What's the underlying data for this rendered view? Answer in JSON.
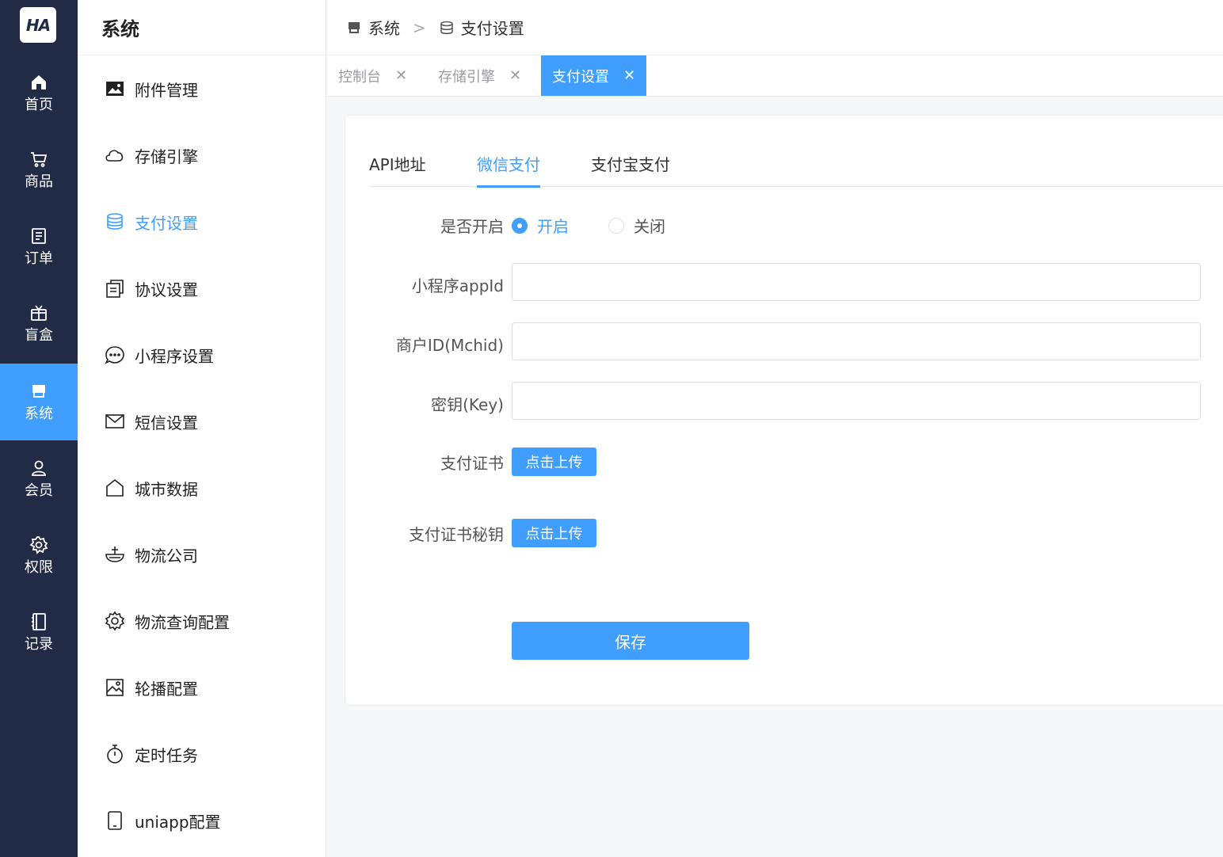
{
  "logo": {
    "text": "HA"
  },
  "rail": {
    "items": [
      {
        "label": "首页",
        "icon": "home-icon"
      },
      {
        "label": "商品",
        "icon": "cart-icon"
      },
      {
        "label": "订单",
        "icon": "document-icon"
      },
      {
        "label": "盲盒",
        "icon": "gift-box-icon"
      },
      {
        "label": "系统",
        "icon": "shop-icon"
      },
      {
        "label": "会员",
        "icon": "user-icon"
      },
      {
        "label": "权限",
        "icon": "gear-icon"
      },
      {
        "label": "记录",
        "icon": "notebook-icon"
      }
    ],
    "active": "系统"
  },
  "submenu": {
    "title": "系统",
    "items": [
      {
        "label": "附件管理",
        "icon": "picture-icon"
      },
      {
        "label": "存储引擎",
        "icon": "cloud-icon"
      },
      {
        "label": "支付设置",
        "icon": "coin-icon"
      },
      {
        "label": "协议设置",
        "icon": "copy-document-icon"
      },
      {
        "label": "小程序设置",
        "icon": "chat-dot-icon"
      },
      {
        "label": "短信设置",
        "icon": "message-icon"
      },
      {
        "label": "城市数据",
        "icon": "house-icon"
      },
      {
        "label": "物流公司",
        "icon": "bowl-icon"
      },
      {
        "label": "物流查询配置",
        "icon": "setting-icon"
      },
      {
        "label": "轮播配置",
        "icon": "image-frame-icon"
      },
      {
        "label": "定时任务",
        "icon": "stopwatch-icon"
      },
      {
        "label": "uniapp配置",
        "icon": "phone-icon"
      }
    ],
    "active": "支付设置"
  },
  "breadcrumb": {
    "root": "系统",
    "current": "支付设置"
  },
  "tags": [
    {
      "label": "控制台"
    },
    {
      "label": "存储引擎"
    },
    {
      "label": "支付设置"
    }
  ],
  "tabs": [
    {
      "label": "API地址"
    },
    {
      "label": "微信支付"
    },
    {
      "label": "支付宝支付"
    }
  ],
  "active_tab": "微信支付",
  "form": {
    "enabled_label": "是否开启",
    "enabled_on": "开启",
    "enabled_off": "关闭",
    "enabled_value": "开启",
    "appid_label": "小程序appId",
    "appid_value": "",
    "mchid_label": "商户ID(Mchid)",
    "mchid_value": "",
    "key_label": "密钥(Key)",
    "key_value": "",
    "cert_label": "支付证书",
    "cert_key_label": "支付证书秘钥",
    "upload_label": "点击上传",
    "save_label": "保存"
  },
  "colors": {
    "primary": "#409eff",
    "rail_bg": "#222b45"
  }
}
